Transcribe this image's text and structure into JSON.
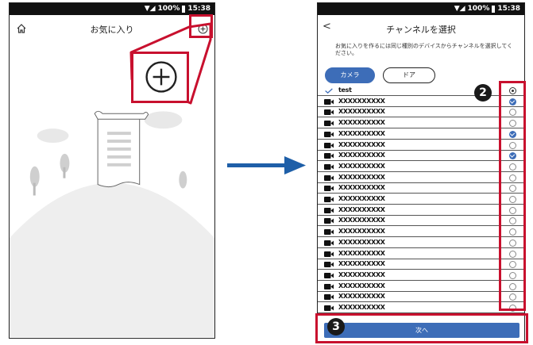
{
  "status_bar": {
    "battery": "100%",
    "time": "15:38"
  },
  "left_screen": {
    "title": "お気に入り",
    "home_icon": "home-icon",
    "add_icon": "plus-circle-icon"
  },
  "right_screen": {
    "title": "チャンネルを選択",
    "back_symbol": "<",
    "description": "お気に入りを作るには同じ種別のデバイスからチャンネルを選択してください。",
    "tabs": [
      {
        "label": "カメラ",
        "active": true
      },
      {
        "label": "ドア",
        "active": false
      }
    ],
    "channels": [
      {
        "label": "test",
        "icon": "check-icon",
        "state": "ring"
      },
      {
        "label": "XXXXXXXXXX",
        "icon": "camera-icon",
        "state": "selected"
      },
      {
        "label": "XXXXXXXXXX",
        "icon": "camera-icon",
        "state": "empty"
      },
      {
        "label": "XXXXXXXXXX",
        "icon": "camera-icon",
        "state": "empty"
      },
      {
        "label": "XXXXXXXXXX",
        "icon": "camera-icon",
        "state": "selected"
      },
      {
        "label": "XXXXXXXXXX",
        "icon": "camera-icon",
        "state": "empty"
      },
      {
        "label": "XXXXXXXXXX",
        "icon": "camera-icon",
        "state": "selected"
      },
      {
        "label": "XXXXXXXXXX",
        "icon": "camera-icon",
        "state": "empty"
      },
      {
        "label": "XXXXXXXXXX",
        "icon": "camera-icon",
        "state": "empty"
      },
      {
        "label": "XXXXXXXXXX",
        "icon": "camera-icon",
        "state": "empty"
      },
      {
        "label": "XXXXXXXXXX",
        "icon": "camera-icon",
        "state": "empty"
      },
      {
        "label": "XXXXXXXXXX",
        "icon": "camera-icon",
        "state": "empty"
      },
      {
        "label": "XXXXXXXXXX",
        "icon": "camera-icon",
        "state": "empty"
      },
      {
        "label": "XXXXXXXXXX",
        "icon": "camera-icon",
        "state": "empty"
      },
      {
        "label": "XXXXXXXXXX",
        "icon": "camera-icon",
        "state": "empty"
      },
      {
        "label": "XXXXXXXXXX",
        "icon": "camera-icon",
        "state": "empty"
      },
      {
        "label": "XXXXXXXXXX",
        "icon": "camera-icon",
        "state": "empty"
      },
      {
        "label": "XXXXXXXXXX",
        "icon": "camera-icon",
        "state": "empty"
      },
      {
        "label": "XXXXXXXXXX",
        "icon": "camera-icon",
        "state": "empty"
      },
      {
        "label": "XXXXXXXXXX",
        "icon": "camera-icon",
        "state": "empty"
      },
      {
        "label": "XXXXXXXXXX",
        "icon": "camera-icon",
        "state": "empty"
      }
    ],
    "next_label": "次へ"
  },
  "annotations": {
    "badge_2": "2",
    "badge_3": "3"
  },
  "colors": {
    "accent": "#3d6db8",
    "callout": "#c8102e",
    "arrow": "#1e5fa8"
  }
}
